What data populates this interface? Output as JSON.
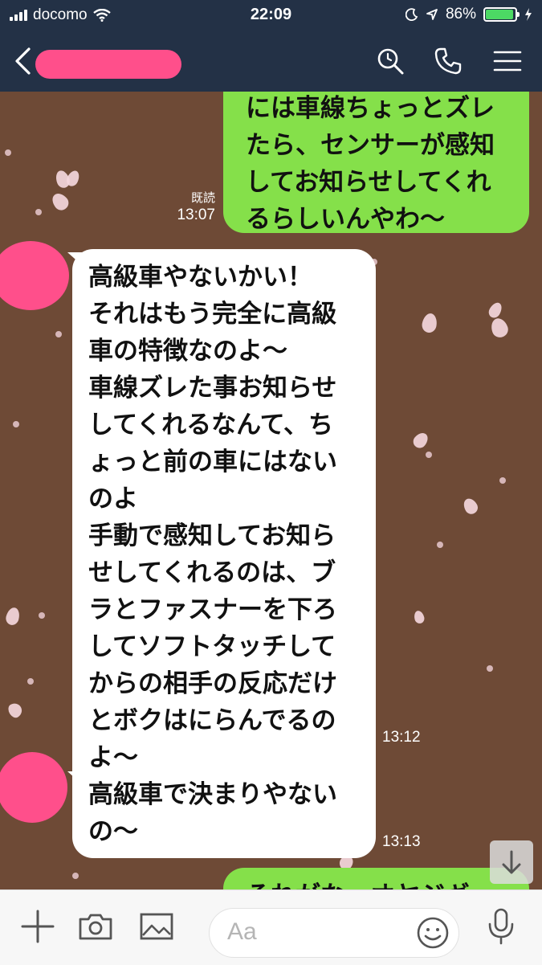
{
  "status_bar": {
    "carrier": "docomo",
    "time": "22:09",
    "battery": "86%"
  },
  "header": {
    "icons": [
      "back-chevron-icon",
      "search-icon",
      "phone-icon",
      "menu-icon"
    ]
  },
  "messages": [
    {
      "direction": "out",
      "lines": [
        "には車線ちょっとズレ",
        "たら、センサーが感知",
        "してお知らせしてくれ",
        "るらしいんやわ〜"
      ],
      "read": "既読",
      "time": "13:07"
    },
    {
      "direction": "in",
      "lines": [
        "高級車やないかい！",
        "それはもう完全に高級",
        "車の特徴なのよ〜",
        "車線ズレた事お知らせ",
        "してくれるなんて、ち",
        "ょっと前の車にはない",
        "のよ",
        "手動で感知してお知ら",
        "せしてくれるのは、ブ",
        "ラとファスナーを下ろ",
        "してソフトタッチして",
        "からの相手の反応だけ",
        "とボクはにらんでるの",
        "よ〜"
      ],
      "time": "13:12"
    },
    {
      "direction": "in",
      "lines": [
        "高級車で決まりやない",
        "の〜"
      ],
      "time": "13:13"
    },
    {
      "direction": "out",
      "lines": [
        "それがな、オヤジギ"
      ],
      "partial": true
    }
  ],
  "input": {
    "placeholder": "Aa",
    "icons": [
      "plus-icon",
      "camera-icon",
      "image-icon",
      "emoji-icon",
      "microphone-icon"
    ]
  },
  "scroll_button": {
    "icon": "arrow-down-icon"
  },
  "colors": {
    "header_bg": "#233146",
    "chat_bg": "#6e4a36",
    "outgoing_bubble": "#85e04a",
    "incoming_bubble": "#ffffff",
    "redaction": "#ff4f8b",
    "battery": "#4cd964"
  }
}
